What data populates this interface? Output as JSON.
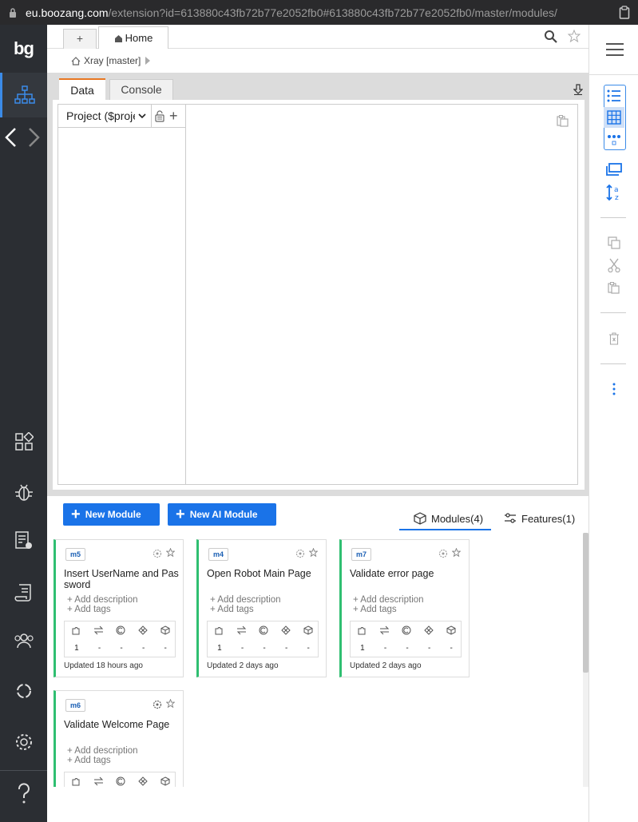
{
  "browser": {
    "url_host": "eu.boozang.com",
    "url_path": "/extension?id=613880c43fb72b77e2052fb0#613880c43fb72b77e2052fb0/master/modules/"
  },
  "app": {
    "logo": "bg"
  },
  "tabs": {
    "new_tab": "+",
    "home": "Home"
  },
  "breadcrumb": {
    "project": "Xray [master]"
  },
  "data_panel": {
    "tabs": [
      "Data",
      "Console"
    ],
    "tree_select": "Project ($project)",
    "tree_add": "+"
  },
  "modules": {
    "new_module_label": "New Module",
    "new_ai_module_label": "New AI Module",
    "tab_modules": "Modules(4)",
    "tab_features": "Features(1)",
    "add_description": "Add description",
    "add_tags": "Add tags",
    "cards": [
      {
        "badge": "m5",
        "title": "Insert UserName and Password",
        "stats": [
          "1",
          "-",
          "-",
          "-",
          "-"
        ],
        "updated": "Updated 18 hours ago"
      },
      {
        "badge": "m4",
        "title": "Open Robot Main Page",
        "stats": [
          "1",
          "-",
          "-",
          "-",
          "-"
        ],
        "updated": "Updated 2 days ago"
      },
      {
        "badge": "m7",
        "title": "Validate error page",
        "stats": [
          "1",
          "-",
          "-",
          "-",
          "-"
        ],
        "updated": "Updated 2 days ago"
      },
      {
        "badge": "m6",
        "title": "Validate Welcome Page",
        "stats": [
          "",
          "",
          "",
          "",
          ""
        ],
        "updated": ""
      }
    ]
  },
  "colors": {
    "accent": "#1a73e8",
    "nav_bg": "#2b2e33",
    "card_border": "#2fbf71",
    "active_tab": "#e87722"
  }
}
